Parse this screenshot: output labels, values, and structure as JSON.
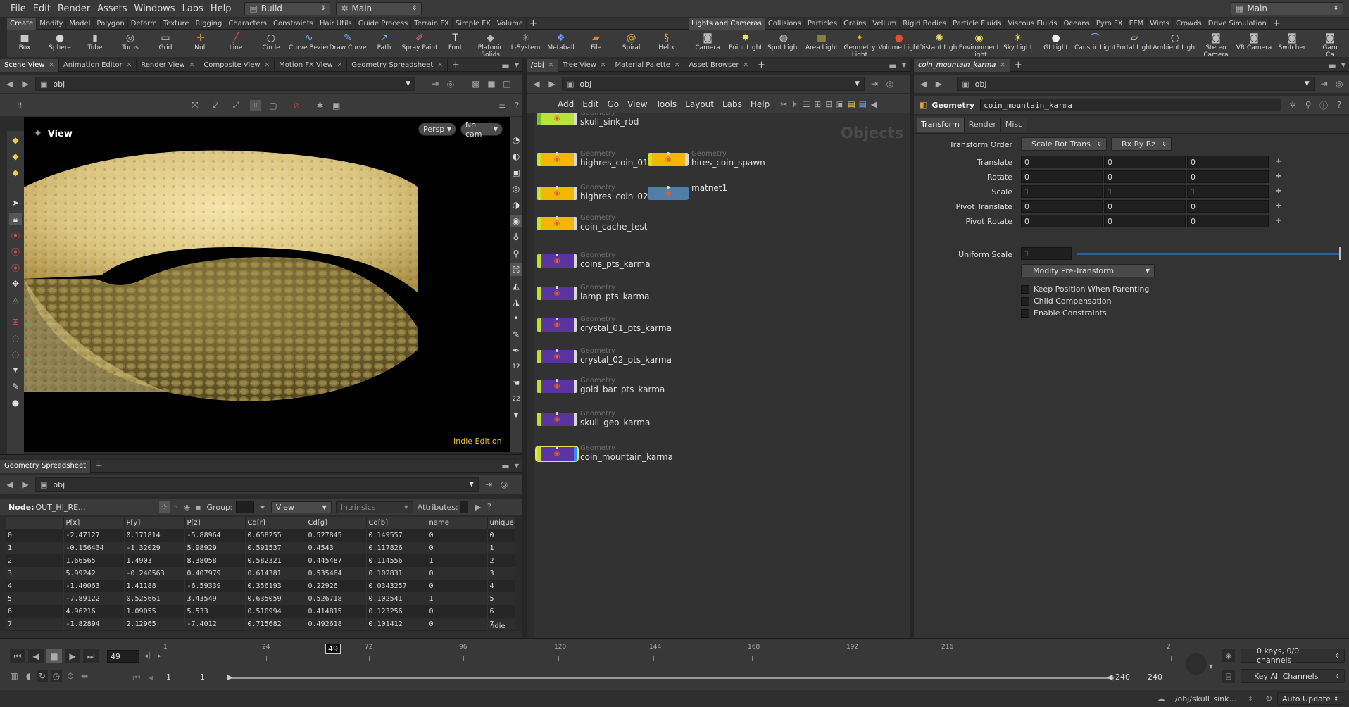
{
  "menubar": {
    "items": [
      "File",
      "Edit",
      "Render",
      "Assets",
      "Windows",
      "Labs",
      "Help"
    ],
    "desktop": "Build",
    "context": "Main",
    "right_context": "Main"
  },
  "shelf_left": {
    "tabs": [
      "Create",
      "Modify",
      "Model",
      "Polygon",
      "Deform",
      "Texture",
      "Rigging",
      "Characters",
      "Constraints",
      "Hair Utils",
      "Guide Process",
      "Terrain FX",
      "Simple FX",
      "Volume"
    ],
    "active_tab": "Create",
    "tools": [
      {
        "label": "Box",
        "icon": "box-icon",
        "glyph": "■",
        "color": "#c8c8c8"
      },
      {
        "label": "Sphere",
        "icon": "sphere-icon",
        "glyph": "●",
        "color": "#d6d6d6"
      },
      {
        "label": "Tube",
        "icon": "tube-icon",
        "glyph": "▮",
        "color": "#c8c8c8"
      },
      {
        "label": "Torus",
        "icon": "torus-icon",
        "glyph": "◎",
        "color": "#c8c8c8"
      },
      {
        "label": "Grid",
        "icon": "grid-icon",
        "glyph": "▭",
        "color": "#c8c8c8"
      },
      {
        "label": "Null",
        "icon": "null-icon",
        "glyph": "✛",
        "color": "#e0a040"
      },
      {
        "label": "Line",
        "icon": "line-icon",
        "glyph": "╱",
        "color": "#e05050"
      },
      {
        "label": "Circle",
        "icon": "circle-icon",
        "glyph": "○",
        "color": "#d0d0d0"
      },
      {
        "label": "Curve Bezier",
        "icon": "curve-bezier-icon",
        "glyph": "∿",
        "color": "#70b0ff"
      },
      {
        "label": "Draw Curve",
        "icon": "draw-curve-icon",
        "glyph": "✎",
        "color": "#70b0ff"
      },
      {
        "label": "Path",
        "icon": "path-icon",
        "glyph": "↗",
        "color": "#70b0ff"
      },
      {
        "label": "Spray Paint",
        "icon": "spray-paint-icon",
        "glyph": "✐",
        "color": "#ff7070"
      },
      {
        "label": "Font",
        "icon": "font-icon",
        "glyph": "T",
        "color": "#dddddd"
      },
      {
        "label": "Platonic\nSolids",
        "icon": "platonic-solids-icon",
        "glyph": "◆",
        "color": "#bbbbbb"
      },
      {
        "label": "L-System",
        "icon": "l-system-icon",
        "glyph": "✳",
        "color": "#70c070"
      },
      {
        "label": "Metaball",
        "icon": "metaball-icon",
        "glyph": "❖",
        "color": "#70a0ff"
      },
      {
        "label": "File",
        "icon": "file-icon",
        "glyph": "▰",
        "color": "#e08040"
      },
      {
        "label": "Spiral",
        "icon": "spiral-icon",
        "glyph": "@",
        "color": "#e0a040"
      },
      {
        "label": "Helix",
        "icon": "helix-icon",
        "glyph": "§",
        "color": "#e0a040"
      }
    ]
  },
  "shelf_right": {
    "tabs": [
      "Lights and Cameras",
      "Collisions",
      "Particles",
      "Grains",
      "Vellum",
      "Rigid Bodies",
      "Particle Fluids",
      "Viscous Fluids",
      "Oceans",
      "Pyro FX",
      "FEM",
      "Wires",
      "Crowds",
      "Drive Simulation"
    ],
    "active_tab": "Lights and Cameras",
    "tools": [
      {
        "label": "Camera",
        "icon": "camera-icon",
        "glyph": "◙",
        "color": "#bbbbbb"
      },
      {
        "label": "Point Light",
        "icon": "point-light-icon",
        "glyph": "✸",
        "color": "#f0e060"
      },
      {
        "label": "Spot Light",
        "icon": "spot-light-icon",
        "glyph": "◍",
        "color": "#dddddd"
      },
      {
        "label": "Area Light",
        "icon": "area-light-icon",
        "glyph": "▥",
        "color": "#f0e060"
      },
      {
        "label": "Geometry\nLight",
        "icon": "geometry-light-icon",
        "glyph": "✦",
        "color": "#f0a030"
      },
      {
        "label": "Volume Light",
        "icon": "volume-light-icon",
        "glyph": "●",
        "color": "#e05030"
      },
      {
        "label": "Distant Light",
        "icon": "distant-light-icon",
        "glyph": "✺",
        "color": "#f0e060"
      },
      {
        "label": "Environment\nLight",
        "icon": "environment-light-icon",
        "glyph": "◉",
        "color": "#f0e060"
      },
      {
        "label": "Sky Light",
        "icon": "sky-light-icon",
        "glyph": "☀",
        "color": "#f0e060"
      },
      {
        "label": "GI Light",
        "icon": "gi-light-icon",
        "glyph": "●",
        "color": "#eeeeee"
      },
      {
        "label": "Caustic Light",
        "icon": "caustic-light-icon",
        "glyph": "⌒",
        "color": "#80b0ff"
      },
      {
        "label": "Portal Light",
        "icon": "portal-light-icon",
        "glyph": "▱",
        "color": "#f0e060"
      },
      {
        "label": "Ambient Light",
        "icon": "ambient-light-icon",
        "glyph": "◌",
        "color": "#eeeeee"
      },
      {
        "label": "Stereo\nCamera",
        "icon": "stereo-camera-icon",
        "glyph": "◙",
        "color": "#bbbbbb"
      },
      {
        "label": "VR Camera",
        "icon": "vr-camera-icon",
        "glyph": "◙",
        "color": "#bbbbbb"
      },
      {
        "label": "Switcher",
        "icon": "switcher-icon",
        "glyph": "◙",
        "color": "#bbbbbb"
      },
      {
        "label": "Gam\nCa",
        "icon": "gamepad-camera-icon",
        "glyph": "◙",
        "color": "#bbbbbb"
      }
    ]
  },
  "viewport_pane": {
    "tabs": [
      "Scene View",
      "Animation Editor",
      "Render View",
      "Composite View",
      "Motion FX View",
      "Geometry Spreadsheet"
    ],
    "path": "obj",
    "title": "View",
    "persp": "Persp",
    "camera": "No cam",
    "watermark": "Indie Edition"
  },
  "spreadsheet_pane": {
    "tab": "Geometry Spreadsheet",
    "path": "obj",
    "node_label": "Node:",
    "node_value": "OUT_HI_RE...",
    "group_label": "Group:",
    "view_label": "View",
    "intrinsics_label": "Intrinsics",
    "attributes_label": "Attributes:",
    "columns": [
      "",
      "P[x]",
      "P[y]",
      "P[z]",
      "Cd[r]",
      "Cd[g]",
      "Cd[b]",
      "name",
      "unique"
    ],
    "rows": [
      [
        "0",
        "-2.47127",
        "0.171814",
        "-5.88964",
        "0.658255",
        "0.527845",
        "0.149557",
        "0",
        "0"
      ],
      [
        "1",
        "-0.156434",
        "-1.32029",
        "5.98929",
        "0.591537",
        "0.4543",
        "0.117826",
        "0",
        "1"
      ],
      [
        "2",
        "1.66565",
        "1.4903",
        "8.38058",
        "0.582321",
        "0.445487",
        "0.114556",
        "1",
        "2"
      ],
      [
        "3",
        "5.99242",
        "-0.240563",
        "0.407979",
        "0.614381",
        "0.535464",
        "0.102831",
        "0",
        "3"
      ],
      [
        "4",
        "-1.40063",
        "1.41188",
        "-6.59339",
        "0.356193",
        "0.22926",
        "0.0343257",
        "0",
        "4"
      ],
      [
        "5",
        "-7.89122",
        "0.525661",
        "3.43549",
        "0.635059",
        "0.526718",
        "0.102541",
        "1",
        "5"
      ],
      [
        "6",
        "4.96216",
        "1.09055",
        "5.533",
        "0.510994",
        "0.414815",
        "0.123256",
        "0",
        "6"
      ],
      [
        "7",
        "-1.82894",
        "2.12965",
        "-7.4012",
        "0.715682",
        "0.492618",
        "0.101412",
        "0",
        "7"
      ]
    ],
    "corner_watermark": "Indie"
  },
  "network_pane": {
    "tabs": [
      "/obj",
      "Tree View",
      "Material Palette",
      "Asset Browser"
    ],
    "path": "obj",
    "menu": [
      "Add",
      "Edit",
      "Go",
      "View",
      "Tools",
      "Layout",
      "Labs",
      "Help"
    ],
    "context_label": "Objects",
    "nodes": [
      {
        "type": "Geometry",
        "name": "skull_sink_rbd",
        "color": "#b8e23c",
        "flag": "#7ac020",
        "right": "#d8d8d8"
      },
      {
        "type": "Geometry",
        "name": "highres_coin_01",
        "color": "#f0b800",
        "flag": "#d0e030",
        "right": "#d8d8d8"
      },
      {
        "type": "Geometry",
        "name": "hires_coin_spawn",
        "color": "#f0b800",
        "flag": "#d0e030",
        "right": "#d8d8d8"
      },
      {
        "type": "Geometry",
        "name": "highres_coin_02",
        "color": "#f0b800",
        "flag": "#d0e030",
        "right": "#d8d8d8"
      },
      {
        "type": "",
        "name": "matnet1",
        "color": "#4f7fa8",
        "flag": "#4f7fa8",
        "right": "#4f7fa8"
      },
      {
        "type": "Geometry",
        "name": "coin_cache_test",
        "color": "#f0b800",
        "flag": "#d0e030",
        "right": "#d8d8d8"
      },
      {
        "type": "Geometry",
        "name": "coins_pts_karma",
        "color": "#5a35a0",
        "flag": "#c0e030",
        "right": "#d8d8d8"
      },
      {
        "type": "Geometry",
        "name": "lamp_pts_karma",
        "color": "#5a35a0",
        "flag": "#c0e030",
        "right": "#d8d8d8"
      },
      {
        "type": "Geometry",
        "name": "crystal_01_pts_karma",
        "color": "#5a35a0",
        "flag": "#c0e030",
        "right": "#d8d8d8"
      },
      {
        "type": "Geometry",
        "name": "crystal_02_pts_karma",
        "color": "#5a35a0",
        "flag": "#c0e030",
        "right": "#d8d8d8"
      },
      {
        "type": "Geometry",
        "name": "gold_bar_pts_karma",
        "color": "#5a35a0",
        "flag": "#c0e030",
        "right": "#d8d8d8"
      },
      {
        "type": "Geometry",
        "name": "skull_geo_karma",
        "color": "#5a35a0",
        "flag": "#c0e030",
        "right": "#d8d8d8"
      },
      {
        "type": "Geometry",
        "name": "coin_mountain_karma",
        "color": "#5a35a0",
        "flag": "#c0e030",
        "right": "#2a8cff"
      }
    ]
  },
  "params_pane": {
    "tab": "coin_mountain_karma",
    "path": "obj",
    "node_type": "Geometry",
    "node_name": "coin_mountain_karma",
    "tabs": [
      "Transform",
      "Render",
      "Misc"
    ],
    "transform_order_label": "Transform Order",
    "transform_order": "Scale Rot Trans",
    "rotate_order": "Rx Ry Rz",
    "rows": [
      {
        "label": "Translate",
        "values": [
          "0",
          "0",
          "0"
        ]
      },
      {
        "label": "Rotate",
        "values": [
          "0",
          "0",
          "0"
        ]
      },
      {
        "label": "Scale",
        "values": [
          "1",
          "1",
          "1"
        ]
      },
      {
        "label": "Pivot Translate",
        "values": [
          "0",
          "0",
          "0"
        ]
      },
      {
        "label": "Pivot Rotate",
        "values": [
          "0",
          "0",
          "0"
        ]
      }
    ],
    "uniform_scale_label": "Uniform Scale",
    "uniform_scale": "1",
    "modify_pre": "Modify Pre-Transform",
    "checkboxes": [
      "Keep Position When Parenting",
      "Child Compensation",
      "Enable Constraints"
    ]
  },
  "timeline": {
    "current_frame": "49",
    "ticks": [
      "1",
      "24",
      "49",
      "72",
      "96",
      "120",
      "144",
      "168",
      "192",
      "216",
      "2"
    ],
    "start": "1",
    "start2": "1",
    "end": "240",
    "end2": "240",
    "keys_info": "0 keys, 0/0 channels",
    "key_all": "Key All Channels"
  },
  "statusbar": {
    "path": "/obj/skull_sink...",
    "update": "Auto Update"
  }
}
